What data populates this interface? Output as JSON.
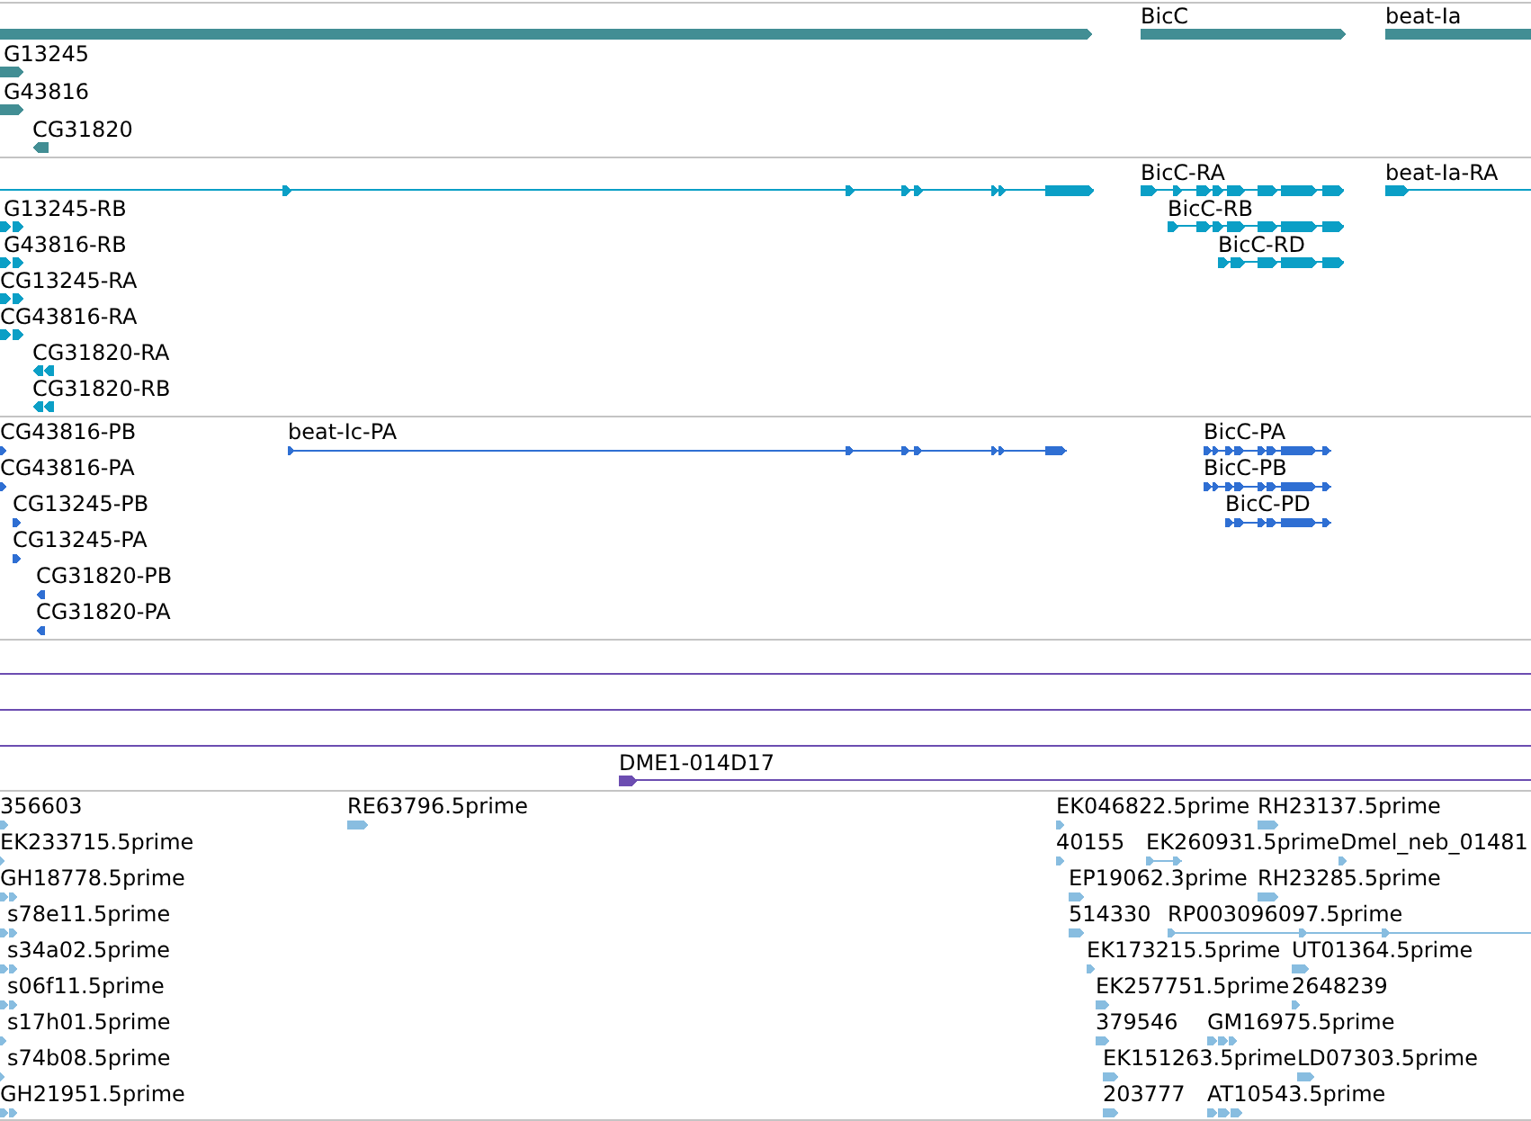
{
  "tracks": [
    {
      "kind": "gene",
      "color": "#428e94",
      "features": [
        {
          "label": "BicC"
        },
        {
          "label": "beat-Ia"
        },
        {
          "label": "G13245"
        },
        {
          "label": "G43816"
        },
        {
          "label": "CG31820"
        }
      ]
    },
    {
      "kind": "transcript",
      "color": "#0b9fc6",
      "features": [
        {
          "label": "BicC-RA"
        },
        {
          "label": "beat-Ia-RA"
        },
        {
          "label": "G13245-RB"
        },
        {
          "label": "BicC-RB"
        },
        {
          "label": "G43816-RB"
        },
        {
          "label": "BicC-RD"
        },
        {
          "label": "CG13245-RA"
        },
        {
          "label": "CG43816-RA"
        },
        {
          "label": "CG31820-RA"
        },
        {
          "label": "CG31820-RB"
        }
      ]
    },
    {
      "kind": "protein",
      "color": "#2f6fd3",
      "features": [
        {
          "label": "CG43816-PB"
        },
        {
          "label": "beat-Ic-PA"
        },
        {
          "label": "BicC-PA"
        },
        {
          "label": "CG43816-PA"
        },
        {
          "label": "BicC-PB"
        },
        {
          "label": "CG13245-PB"
        },
        {
          "label": "BicC-PD"
        },
        {
          "label": "CG13245-PA"
        },
        {
          "label": "CG31820-PB"
        },
        {
          "label": "CG31820-PA"
        }
      ]
    },
    {
      "kind": "clone",
      "color": "#6c4db1",
      "features": [
        {
          "label": "DME1-014D17"
        }
      ]
    },
    {
      "kind": "est",
      "color": "#88bde0",
      "features": [
        {
          "label": "356603"
        },
        {
          "label": "RE63796.5prime"
        },
        {
          "label": "EK046822.5prime"
        },
        {
          "label": "RH23137.5prime"
        },
        {
          "label": "EK233715.5prime"
        },
        {
          "label": "40155"
        },
        {
          "label": "EK260931.5prime"
        },
        {
          "label": "Dmel_neb_01481"
        },
        {
          "label": "GH18778.5prime"
        },
        {
          "label": "EP19062.3prime"
        },
        {
          "label": "RH23285.5prime"
        },
        {
          "label": "s78e11.5prime"
        },
        {
          "label": "514330"
        },
        {
          "label": "RP003096097.5prime"
        },
        {
          "label": "s34a02.5prime"
        },
        {
          "label": "EK173215.5prime"
        },
        {
          "label": "UT01364.5prime"
        },
        {
          "label": "s06f11.5prime"
        },
        {
          "label": "EK257751.5prime"
        },
        {
          "label": "2648239"
        },
        {
          "label": "s17h01.5prime"
        },
        {
          "label": "379546"
        },
        {
          "label": "GM16975.5prime"
        },
        {
          "label": "s74b08.5prime"
        },
        {
          "label": "EK151263.5prime"
        },
        {
          "label": "LD07303.5prime"
        },
        {
          "label": "GH21951.5prime"
        },
        {
          "label": "203777"
        },
        {
          "label": "AT10543.5prime"
        }
      ]
    }
  ]
}
